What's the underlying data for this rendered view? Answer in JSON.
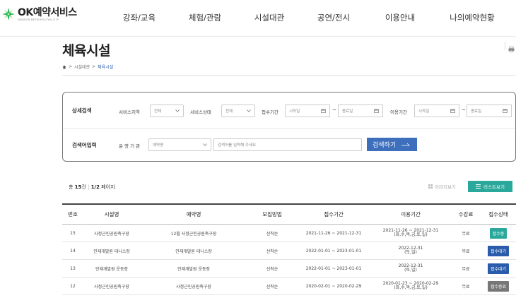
{
  "header": {
    "logo_main": "OK예약서비스",
    "logo_sub": "DAEJEON METROPOLITAN CITY",
    "nav": [
      "강좌/교육",
      "체험/관람",
      "시설대관",
      "공연/전시",
      "이용안내",
      "나의예약현황"
    ]
  },
  "page": {
    "title": "체육시설",
    "breadcrumb": [
      "시설대관",
      "체육시설"
    ]
  },
  "search": {
    "detail_label": "상세검색",
    "keyword_label": "검색어입력",
    "region_label": "서비스지역",
    "region_value": "전체",
    "status_label": "서비스상태",
    "status_value": "전체",
    "apply_label": "접수기간",
    "use_label": "이용기간",
    "start_placeholder": "시작일",
    "end_placeholder": "종료일",
    "tilde": "~",
    "org_label": "운 영 기 관",
    "org_value": "예약명",
    "keyword_placeholder": "검색어를 입력해 주세요",
    "button": "검색하기"
  },
  "results": {
    "total_prefix": "총 ",
    "total": "15",
    "total_suffix": "건",
    "sep": " | ",
    "page": "1/2",
    "page_suffix": " 페이지",
    "view_image": "이미지보기",
    "view_list": "리스트보기"
  },
  "table": {
    "headers": [
      "번호",
      "시설명",
      "예약명",
      "모집방법",
      "접수기간",
      "이용기간",
      "수강료",
      "접수상태"
    ],
    "rows": [
      {
        "no": "15",
        "facility": "사정근린공원축구장",
        "name": "12월 사정근린공원축구장",
        "method": "선착순",
        "apply": "2021-11-26 ~ 2021-12-31",
        "use1": "2021-11-26 ~ 2021-12-31",
        "use2": "(화,수,목,금,토,일)",
        "fee": "무료",
        "status": "접수중",
        "status_color": "#2aa89b"
      },
      {
        "no": "14",
        "facility": "인재개발원 테니스장",
        "name": "인재개발원 테니스장",
        "method": "선착순",
        "apply": "2022-01-01 ~ 2023-01-01",
        "use1": "2022-12-31",
        "use2": "(토,일)",
        "fee": "무료",
        "status": "접수대기",
        "status_color": "#2a5cab"
      },
      {
        "no": "13",
        "facility": "인재개발원 운동장",
        "name": "인재개발원 운동장",
        "method": "선착순",
        "apply": "2022-01-01 ~ 2023-01-01",
        "use1": "2022-12-31",
        "use2": "(토,일)",
        "fee": "무료",
        "status": "접수대기",
        "status_color": "#2a5cab"
      },
      {
        "no": "12",
        "facility": "사정근린공원축구장",
        "name": "사정근린공원축구장",
        "method": "선착순",
        "apply": "2020-02-01 ~ 2020-02-29",
        "use1": "2020-01-23 ~ 2020-02-29",
        "use2": "(화,수,목,금,토,일)",
        "fee": "무료",
        "status": "접수종료",
        "status_color": "#777777"
      }
    ]
  }
}
